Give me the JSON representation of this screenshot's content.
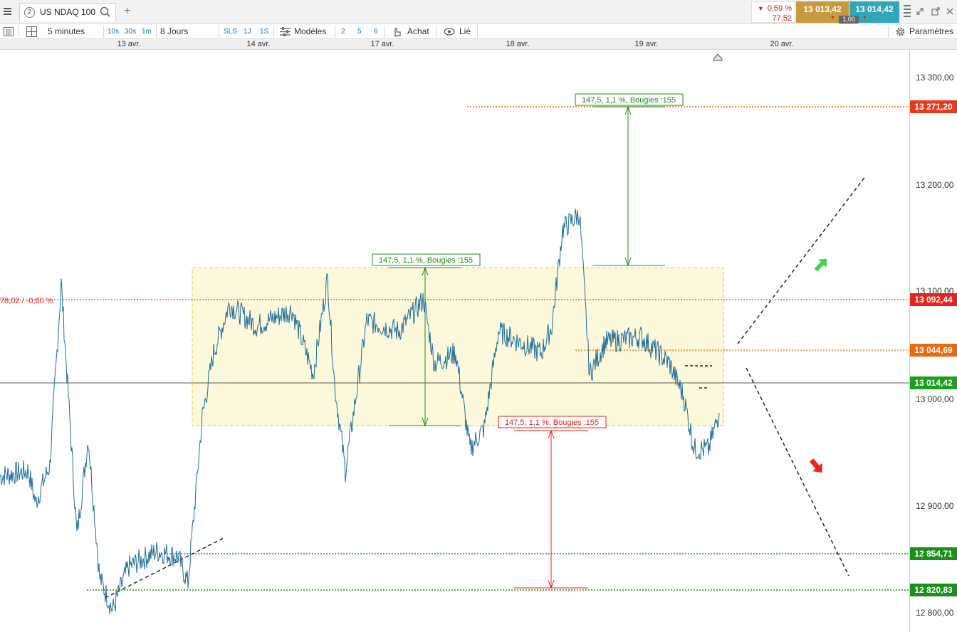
{
  "window": {
    "tab_number": "2",
    "instrument": "US NDAQ 100",
    "add_tab": "+"
  },
  "quote": {
    "change_pct": "0,59 %",
    "change_abs": "77,52",
    "bid": "13 013,42",
    "ask": "13 014,42",
    "spread": "1,00"
  },
  "toolbar": {
    "interval": "5 minutes",
    "buttons": [
      "10s",
      "30s",
      "1m"
    ],
    "range": "8 Jours",
    "sls": "SLS",
    "r1j": "1J",
    "r1s": "1S",
    "models": "Modèles",
    "n2": "2",
    "n5": "5",
    "n6": "6",
    "buy": "Achat",
    "linked": "Lié",
    "settings": "Paramètres"
  },
  "dates": [
    "13 avr.",
    "14 avr.",
    "17 avr.",
    "18 avr.",
    "19 avr.",
    "20 avr."
  ],
  "axis": {
    "ticks": [
      "13 300,00",
      "13 200,00",
      "13 100,00",
      "13 000,00",
      "12 900,00",
      "12 800,00"
    ]
  },
  "price_labels": {
    "upper_target": "13 271,20",
    "prev_close": "13 092,44",
    "resistance": "13 044,69",
    "last": "13 014,42",
    "support1": "12 854,71",
    "support2": "12 820,83"
  },
  "prev_close_text": "78,02 / -0,60 %",
  "measures": {
    "top": "147,5, 1,1 %, Bougies :155",
    "middle": "147,5, 1,1 %, Bougies :155",
    "bottom": "147,5, 1,1 %, Bougies :155"
  },
  "colors": {
    "series": "#1f6e98",
    "red": "#e8231b",
    "green": "#1a8f1a",
    "orange": "#e86a10",
    "bid_bg": "#c69a3e",
    "ask_bg": "#2ea7b8",
    "range_fill": "#fcf8dc"
  },
  "chart_data": {
    "type": "line",
    "ylim": [
      12780,
      13330
    ],
    "price_points": [
      {
        "x": 0,
        "y": 12955
      },
      {
        "x": 40,
        "y": 12960
      },
      {
        "x": 50,
        "y": 12930
      },
      {
        "x": 70,
        "y": 12965
      },
      {
        "x": 86,
        "y": 13135
      },
      {
        "x": 95,
        "y": 13040
      },
      {
        "x": 108,
        "y": 12900
      },
      {
        "x": 124,
        "y": 12990
      },
      {
        "x": 140,
        "y": 12860
      },
      {
        "x": 158,
        "y": 12830
      },
      {
        "x": 180,
        "y": 12870
      },
      {
        "x": 220,
        "y": 12885
      },
      {
        "x": 250,
        "y": 12880
      },
      {
        "x": 264,
        "y": 12855
      },
      {
        "x": 284,
        "y": 13010
      },
      {
        "x": 300,
        "y": 13070
      },
      {
        "x": 322,
        "y": 13115
      },
      {
        "x": 360,
        "y": 13095
      },
      {
        "x": 410,
        "y": 13110
      },
      {
        "x": 440,
        "y": 13050
      },
      {
        "x": 460,
        "y": 13140
      },
      {
        "x": 470,
        "y": 13040
      },
      {
        "x": 485,
        "y": 12960
      },
      {
        "x": 515,
        "y": 13100
      },
      {
        "x": 560,
        "y": 13090
      },
      {
        "x": 595,
        "y": 13120
      },
      {
        "x": 610,
        "y": 13060
      },
      {
        "x": 640,
        "y": 13070
      },
      {
        "x": 660,
        "y": 12980
      },
      {
        "x": 680,
        "y": 13000
      },
      {
        "x": 700,
        "y": 13090
      },
      {
        "x": 760,
        "y": 13070
      },
      {
        "x": 775,
        "y": 13095
      },
      {
        "x": 790,
        "y": 13185
      },
      {
        "x": 814,
        "y": 13200
      },
      {
        "x": 828,
        "y": 13050
      },
      {
        "x": 850,
        "y": 13080
      },
      {
        "x": 900,
        "y": 13085
      },
      {
        "x": 940,
        "y": 13060
      },
      {
        "x": 960,
        "y": 13030
      },
      {
        "x": 975,
        "y": 12980
      },
      {
        "x": 995,
        "y": 12980
      },
      {
        "x": 1010,
        "y": 13014
      }
    ]
  }
}
